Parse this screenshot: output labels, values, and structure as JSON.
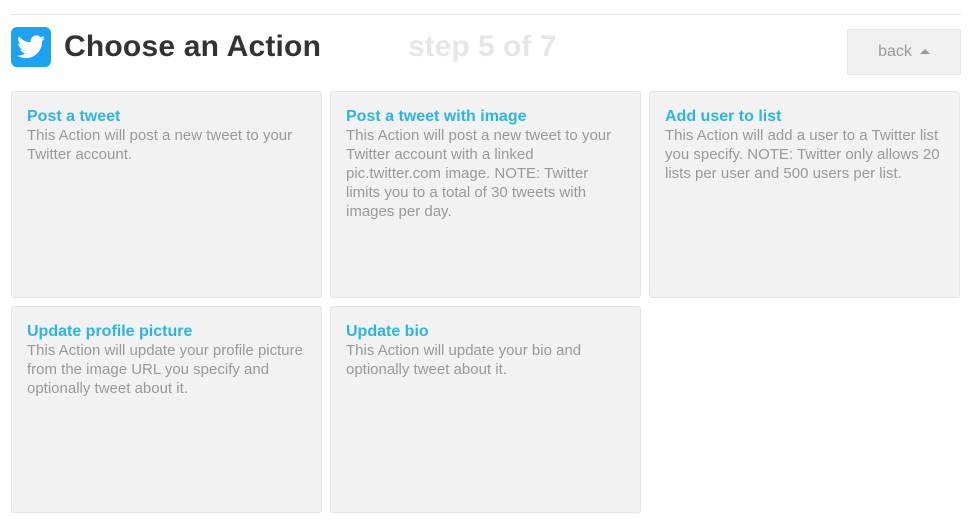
{
  "header": {
    "channel_icon": "twitter-bird-icon",
    "title": "Choose an Action",
    "step": "step 5 of 7",
    "back_label": "back",
    "back_icon": "caret-up-icon"
  },
  "colors": {
    "brand": "#1da1f2",
    "card_title": "#29b6e6",
    "card_text": "#999999",
    "card_bg": "#f2f2f2"
  },
  "actions": [
    {
      "title": "Post a tweet",
      "description": "This Action will post a new tweet to your Twitter account."
    },
    {
      "title": "Post a tweet with image",
      "description": "This Action will post a new tweet to your Twitter account with a linked pic.twitter.com image. NOTE: Twitter limits you to a total of 30 tweets with images per day."
    },
    {
      "title": "Add user to list",
      "description": "This Action will add a user to a Twitter list you specify. NOTE: Twitter only allows 20 lists per user and 500 users per list."
    },
    {
      "title": "Update profile picture",
      "description": "This Action will update your profile picture from the image URL you specify and optionally tweet about it."
    },
    {
      "title": "Update bio",
      "description": "This Action will update your bio and optionally tweet about it."
    }
  ]
}
